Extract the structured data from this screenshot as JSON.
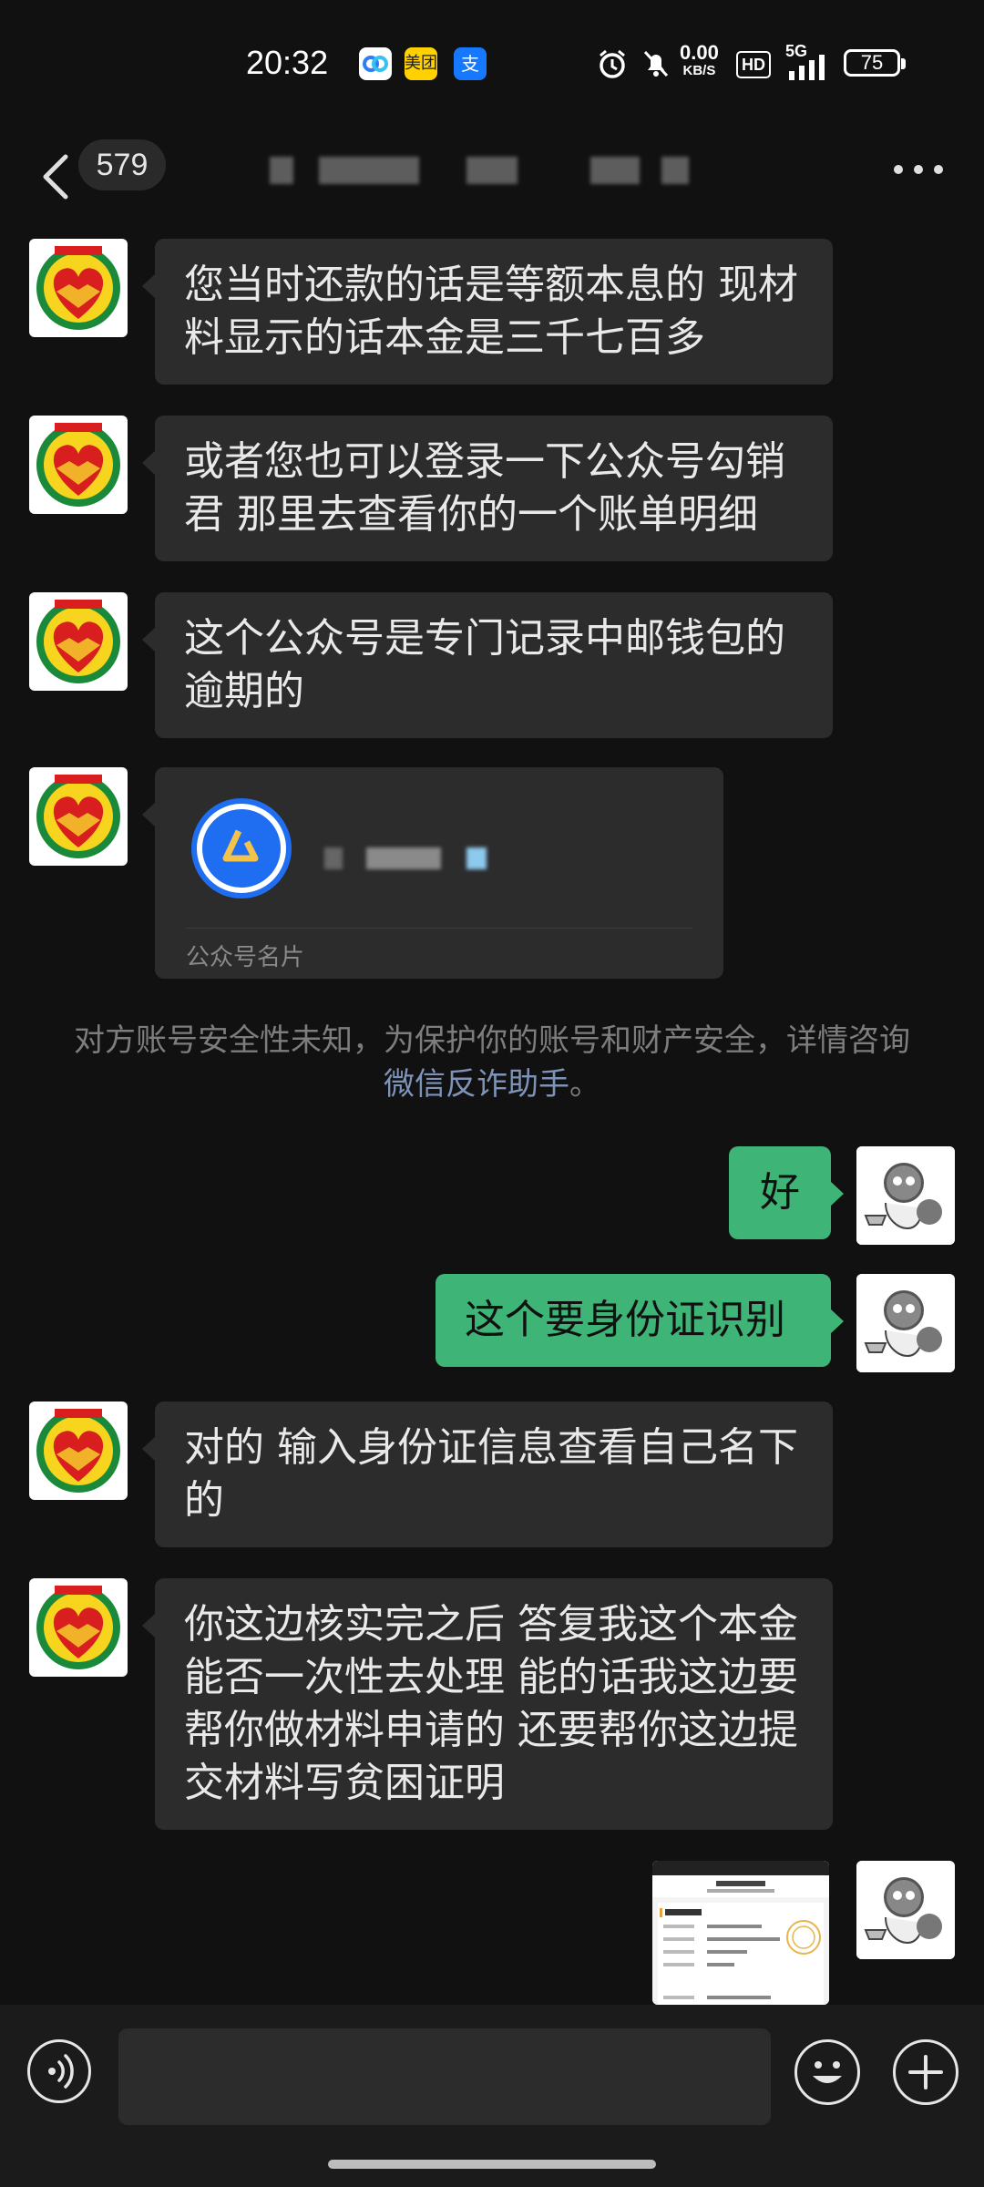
{
  "status_bar": {
    "time": "20:32",
    "app_icons": [
      "cloud-sync-icon",
      "meituan-icon",
      "alipay-icon"
    ],
    "meituan_label": "美团",
    "alipay_label": "支",
    "net_speed_value": "0.00",
    "net_speed_unit": "KB/S",
    "hd_label": "HD",
    "network_label": "5G",
    "battery_level": "75"
  },
  "header": {
    "unread_count": "579",
    "title": ""
  },
  "messages": [
    {
      "side": "left",
      "text": "您当时还款的话是等额本息的 现材料显示的话本金是三千七百多"
    },
    {
      "side": "left",
      "text": "或者您也可以登录一下公众号勾销君 那里去查看你的一个账单明细"
    },
    {
      "side": "left",
      "text": "这个公众号是专门记录中邮钱包的逾期的"
    },
    {
      "side": "left",
      "type": "card",
      "label": "公众号名片"
    },
    {
      "side": "system",
      "text": "对方账号安全性未知，为保护你的账号和财产安全，详情咨询",
      "link": "微信反诈助手",
      "suffix": "。"
    },
    {
      "side": "right",
      "text": "好"
    },
    {
      "side": "right",
      "text": "这个要身份证识别"
    },
    {
      "side": "left",
      "text": "对的 输入身份证信息查看自己名下的"
    },
    {
      "side": "left",
      "text": "你这边核实完之后 答复我这个本金能否一次性去处理 能的话我这边要帮你做材料申请的 还要帮你这边提交材料写贫困证明"
    },
    {
      "side": "right",
      "type": "image"
    }
  ],
  "colors": {
    "background": "#111111",
    "bubble_other": "#2c2c2c",
    "bubble_mine": "#3eb476",
    "link": "#7e93b8"
  }
}
